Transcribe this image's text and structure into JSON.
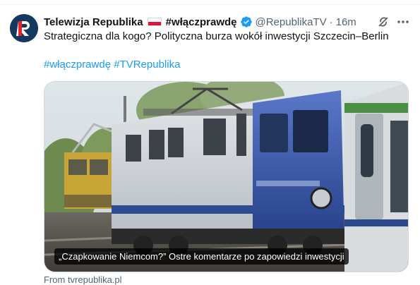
{
  "tweet": {
    "author": {
      "display_name": "Telewizja Republika",
      "flag": "Polish flag",
      "hashtag_name": "#włączprawdę",
      "handle": "@RepublikaTV",
      "separator": "·",
      "time": "16m",
      "avatar_letter": "R"
    },
    "text": "Strategiczna dla kogo? Polityczna burza wokół inwestycji Szczecin–Berlin",
    "hashtags": [
      "#włączprawdę",
      "#TVRepublika"
    ],
    "card": {
      "caption": "„Czapkowanie Niemcom?” Ostre komentarze po zapowiedzi inwestycji",
      "source": "From tvrepublika.pl"
    }
  },
  "colors": {
    "link": "#1d9bf0",
    "secondary_text": "#536471",
    "avatar_bg": "#14385f",
    "avatar_accent": "#e3242b",
    "verified": "#1d9bf0"
  },
  "icons": {
    "verified": "verified-badge-icon",
    "grok": "grok-icon",
    "more": "more-icon"
  }
}
